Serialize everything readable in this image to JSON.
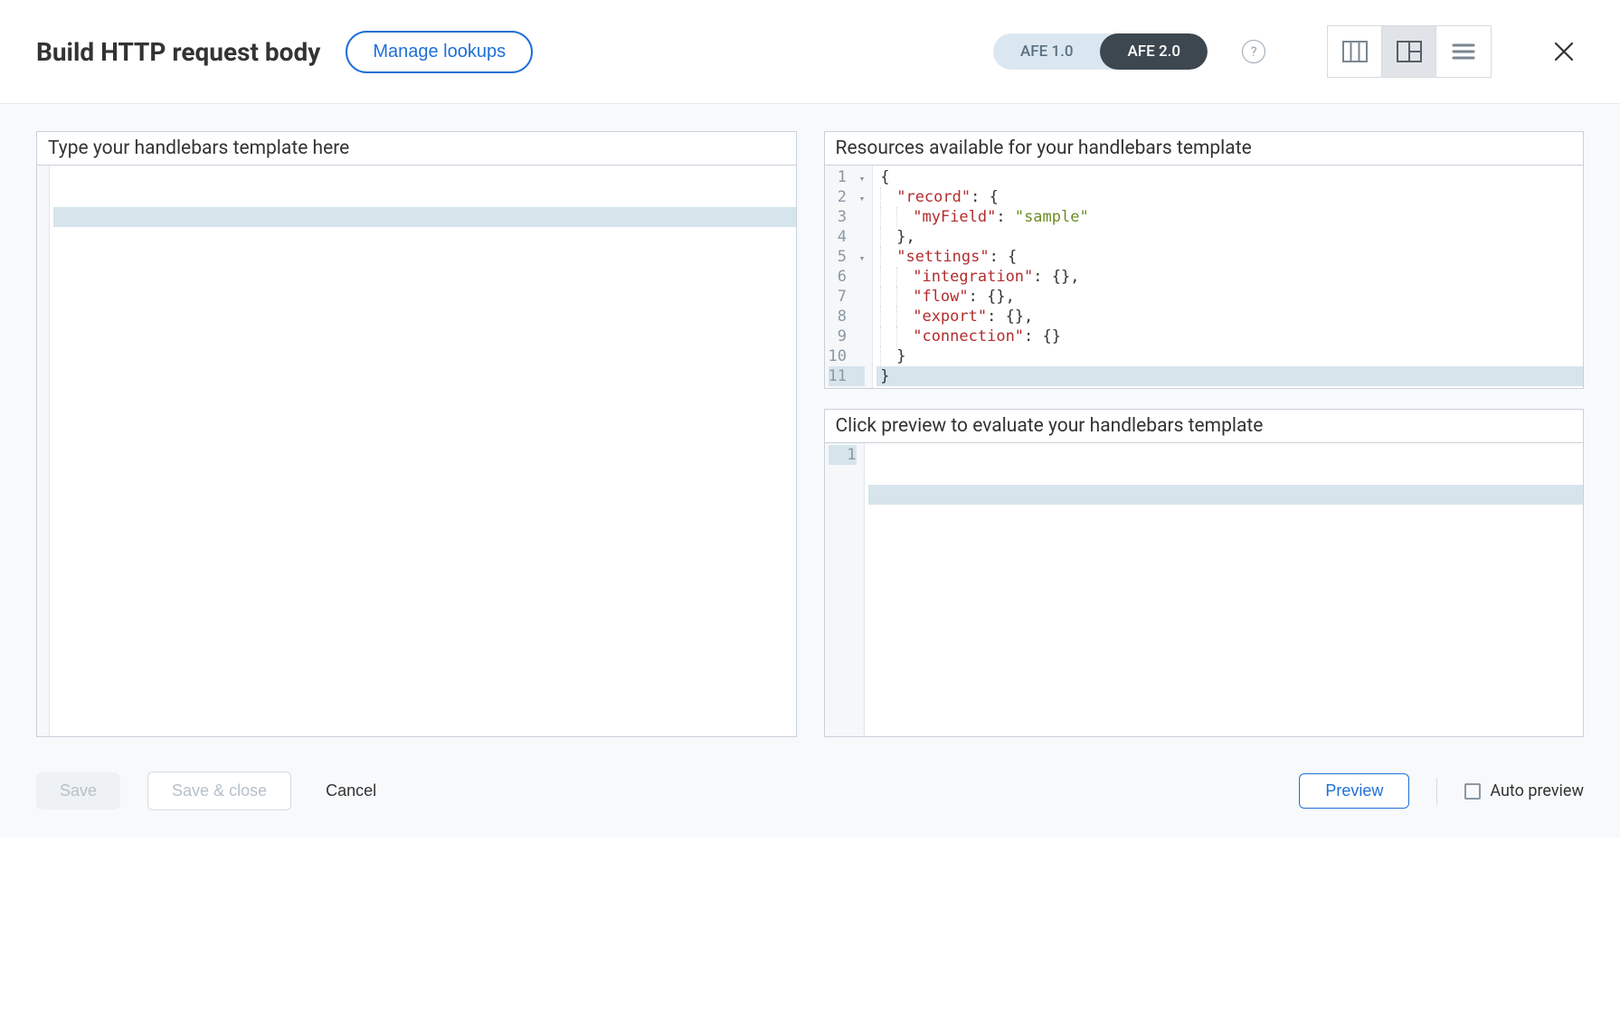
{
  "title": "Build HTTP request body",
  "header": {
    "manage_lookups": "Manage lookups",
    "afe_toggle": {
      "opt1": "AFE 1.0",
      "opt2": "AFE 2.0",
      "active": "AFE 2.0"
    },
    "help_glyph": "?"
  },
  "panels": {
    "template_head": "Type your handlebars template here",
    "resources_head": "Resources available for your handlebars template",
    "preview_head": "Click preview to evaluate your handlebars template"
  },
  "resource_lines": [
    {
      "n": "1",
      "fold": true,
      "indent": 0,
      "tokens": [
        {
          "t": "{",
          "c": "punc"
        }
      ]
    },
    {
      "n": "2",
      "fold": true,
      "indent": 1,
      "tokens": [
        {
          "t": "\"record\"",
          "c": "key"
        },
        {
          "t": ": {",
          "c": "punc"
        }
      ]
    },
    {
      "n": "3",
      "fold": false,
      "indent": 2,
      "tokens": [
        {
          "t": "\"myField\"",
          "c": "key"
        },
        {
          "t": ": ",
          "c": "punc"
        },
        {
          "t": "\"sample\"",
          "c": "str"
        }
      ]
    },
    {
      "n": "4",
      "fold": false,
      "indent": 1,
      "tokens": [
        {
          "t": "},",
          "c": "punc"
        }
      ]
    },
    {
      "n": "5",
      "fold": true,
      "indent": 1,
      "tokens": [
        {
          "t": "\"settings\"",
          "c": "key"
        },
        {
          "t": ": {",
          "c": "punc"
        }
      ]
    },
    {
      "n": "6",
      "fold": false,
      "indent": 2,
      "tokens": [
        {
          "t": "\"integration\"",
          "c": "key"
        },
        {
          "t": ": {},",
          "c": "punc"
        }
      ]
    },
    {
      "n": "7",
      "fold": false,
      "indent": 2,
      "tokens": [
        {
          "t": "\"flow\"",
          "c": "key"
        },
        {
          "t": ": {},",
          "c": "punc"
        }
      ]
    },
    {
      "n": "8",
      "fold": false,
      "indent": 2,
      "tokens": [
        {
          "t": "\"export\"",
          "c": "key"
        },
        {
          "t": ": {},",
          "c": "punc"
        }
      ]
    },
    {
      "n": "9",
      "fold": false,
      "indent": 2,
      "tokens": [
        {
          "t": "\"connection\"",
          "c": "key"
        },
        {
          "t": ": {}",
          "c": "punc"
        }
      ]
    },
    {
      "n": "10",
      "fold": false,
      "indent": 1,
      "tokens": [
        {
          "t": "}",
          "c": "punc"
        }
      ]
    },
    {
      "n": "11",
      "fold": false,
      "indent": 0,
      "hl": true,
      "tokens": [
        {
          "t": "}",
          "c": "punc"
        }
      ]
    }
  ],
  "preview_lines": [
    "1"
  ],
  "footer": {
    "save": "Save",
    "save_close": "Save & close",
    "cancel": "Cancel",
    "preview": "Preview",
    "auto_preview": "Auto preview"
  }
}
